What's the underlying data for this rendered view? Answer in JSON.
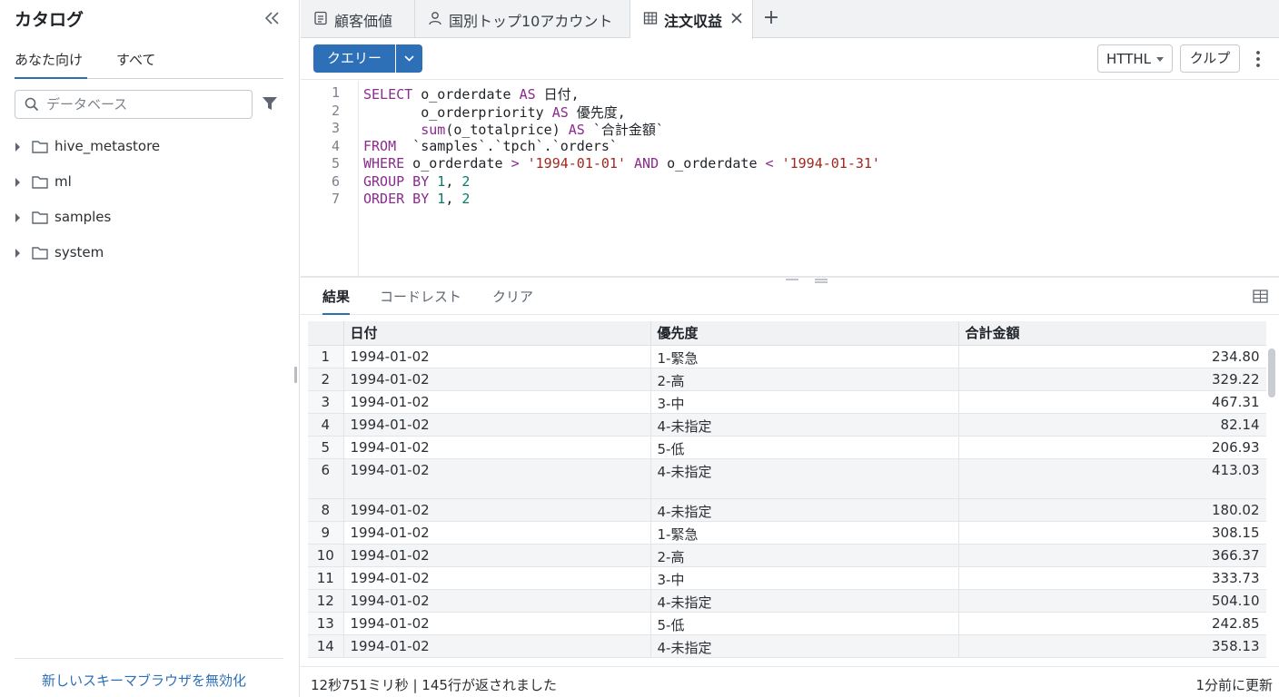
{
  "sidebar": {
    "title": "カタログ",
    "tabs": [
      "あなた向け",
      "すべて"
    ],
    "search_placeholder": "データベース",
    "tree": [
      "hive_metastore",
      "ml",
      "samples",
      "system"
    ],
    "footer_link": "新しいスキーマブラウザを無効化"
  },
  "tabs": [
    {
      "label": "顧客価値",
      "icon": "document-icon"
    },
    {
      "label": "国別トップ10アカウント",
      "icon": "person-icon"
    },
    {
      "label": "注文収益",
      "icon": "table-icon",
      "active": true
    }
  ],
  "toolbar": {
    "run_label": "クエリー",
    "format_value": "HTTHL",
    "clip_label": "クルプ"
  },
  "editor": {
    "line_numbers": [
      "1",
      "2",
      "3",
      "4",
      "5",
      "6",
      "7"
    ]
  },
  "results": {
    "tabs": [
      "結果",
      "コードレスト",
      "クリア"
    ],
    "columns": [
      "日付",
      "優先度",
      "合計金額"
    ],
    "rows": [
      {
        "n": "1",
        "date": "1994-01-02",
        "priority": "1-緊急",
        "total": "234.80"
      },
      {
        "n": "2",
        "date": "1994-01-02",
        "priority": "2-高",
        "total": "329.22"
      },
      {
        "n": "3",
        "date": "1994-01-02",
        "priority": "3-中",
        "total": "467.31"
      },
      {
        "n": "4",
        "date": "1994-01-02",
        "priority": "4-未指定",
        "total": "82.14"
      },
      {
        "n": "5",
        "date": "1994-01-02",
        "priority": "5-低",
        "total": "206.93"
      },
      {
        "n": "6",
        "date": "1994-01-02",
        "priority": "4-未指定",
        "total": "413.03"
      },
      {
        "n": "8",
        "date": "1994-01-02",
        "priority": "4-未指定",
        "total": "180.02"
      },
      {
        "n": "9",
        "date": "1994-01-02",
        "priority": "1-緊急",
        "total": "308.15"
      },
      {
        "n": "10",
        "date": "1994-01-02",
        "priority": "2-高",
        "total": "366.37"
      },
      {
        "n": "11",
        "date": "1994-01-02",
        "priority": "3-中",
        "total": "333.73"
      },
      {
        "n": "12",
        "date": "1994-01-02",
        "priority": "4-未指定",
        "total": "504.10"
      },
      {
        "n": "13",
        "date": "1994-01-02",
        "priority": "5-低",
        "total": "242.85"
      },
      {
        "n": "14",
        "date": "1994-01-02",
        "priority": "4-未指定",
        "total": "358.13"
      }
    ]
  },
  "status": {
    "left": "12秒751ミリ秒 | 145行が返されました",
    "right": "1分前に更新"
  },
  "colors": {
    "accent": "#2d70b8",
    "keyword": "#8b2a8f",
    "string": "#a0281e",
    "number": "#0b7a6b"
  }
}
